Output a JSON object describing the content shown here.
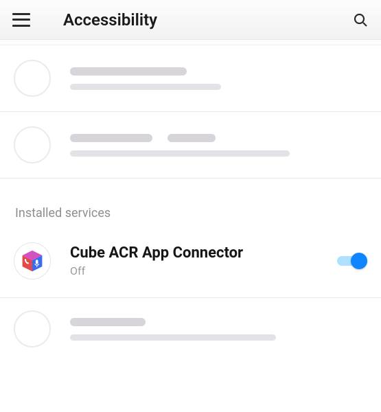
{
  "header": {
    "title": "Accessibility"
  },
  "section": {
    "installed_services_label": "Installed services"
  },
  "service": {
    "name": "Cube ACR App Connector",
    "status": "Off",
    "toggle_on": true,
    "icon_name": "cube-acr-app-icon"
  }
}
